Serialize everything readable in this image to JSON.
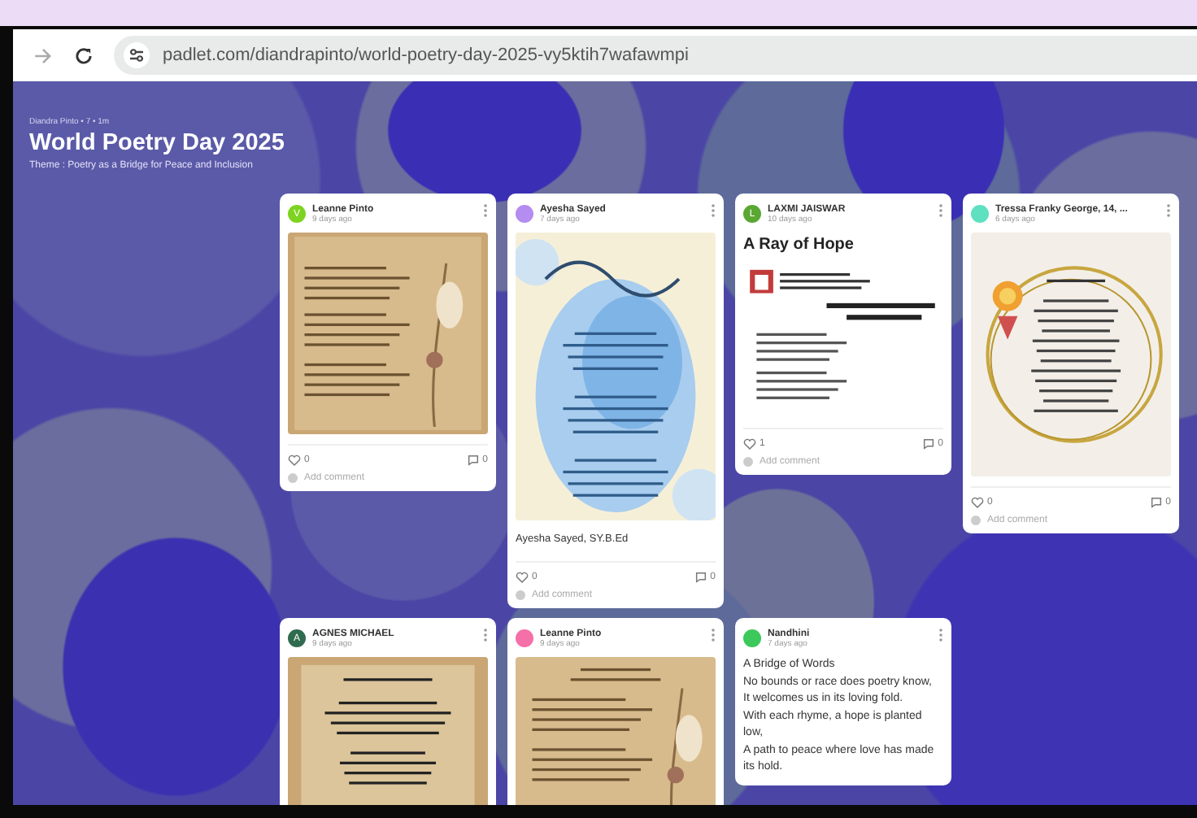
{
  "browser": {
    "back_disabled": true,
    "url": "padlet.com/diandrapinto/world-poetry-day-2025-vy5ktih7wafawmpi"
  },
  "board": {
    "byline": "Diandra Pinto • 7 • 1m",
    "title": "World Poetry Day 2025",
    "subtitle": "Theme : Poetry as a Bridge for Peace and Inclusion"
  },
  "rows": [
    {
      "cards": [
        {
          "author": "Leanne Pinto",
          "time": "9 days ago",
          "color": "#7ed321",
          "avatar_initial": "V",
          "likes": "0",
          "comments": "0",
          "comment_placeholder": "Add comment"
        },
        {
          "author": "Ayesha Sayed",
          "time": "7 days ago",
          "color": "#b58cf0",
          "caption": "Ayesha Sayed, SY.B.Ed",
          "likes": "0",
          "comments": "0",
          "comment_placeholder": "Add comment"
        },
        {
          "author": "LAXMI JAISWAR",
          "time": "10 days ago",
          "color": "#5aa832",
          "avatar_initial": "L",
          "title": "A Ray of Hope",
          "likes": "1",
          "comments": "0",
          "comment_placeholder": "Add comment"
        },
        {
          "author": "Tressa Franky George, 14, ...",
          "time": "6 days ago",
          "color": "#5fe0c0",
          "likes": "0",
          "comments": "0",
          "comment_placeholder": "Add comment"
        }
      ]
    },
    {
      "cards": [
        {
          "author": "AGNES MICHAEL",
          "time": "9 days ago",
          "color": "#2f6b4f",
          "avatar_initial": "A"
        },
        {
          "author": "Leanne Pinto",
          "time": "9 days ago",
          "color": "#f56fa8"
        },
        {
          "author": "Nandhini",
          "time": "7 days ago",
          "color": "#3cc85a",
          "body": [
            "A Bridge of Words",
            "No bounds or race does poetry know,",
            "It welcomes us in its loving fold.",
            "With each rhyme, a hope is planted low,",
            "A path to peace where love has made its hold."
          ]
        }
      ]
    }
  ]
}
